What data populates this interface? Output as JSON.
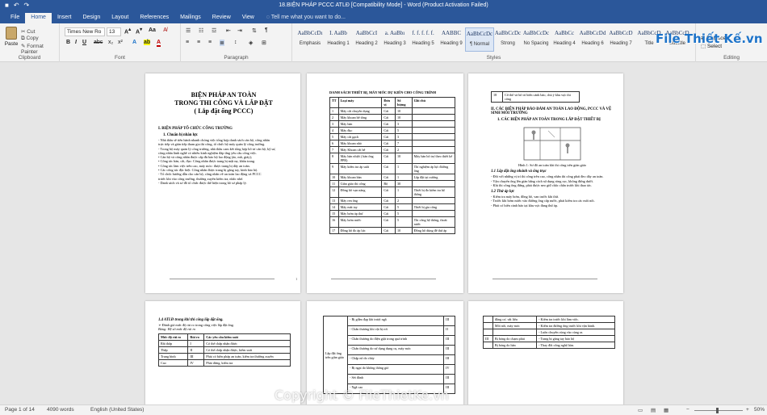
{
  "window": {
    "title": "18.BIỆN PHÁP PCCC  ATLĐ [Compatibility Mode] - Word (Product Activation Failed)"
  },
  "tabs": [
    "File",
    "Home",
    "Insert",
    "Design",
    "Layout",
    "References",
    "Mailings",
    "Review",
    "View"
  ],
  "active_tab": "Home",
  "tell_me": "Tell me what you want to do...",
  "clipboard": {
    "paste": "Paste",
    "cut": "Cut",
    "copy": "Copy",
    "format_painter": "Format Painter",
    "label": "Clipboard"
  },
  "font": {
    "name": "Times New Ro",
    "size": "13",
    "label": "Font"
  },
  "paragraph": {
    "label": "Paragraph"
  },
  "styles": {
    "label": "Styles",
    "items": [
      {
        "preview": "AaBbCcDı",
        "name": "Emphasis"
      },
      {
        "preview": "I. AaBb",
        "name": "Heading 1"
      },
      {
        "preview": "AaBbCcI",
        "name": "Heading 2"
      },
      {
        "preview": "a. AaBbı",
        "name": "Heading 3"
      },
      {
        "preview": "f. f. f. f. f.",
        "name": "Heading 5"
      },
      {
        "preview": "AABBC",
        "name": "Heading 9"
      },
      {
        "preview": "AaBbCcDc",
        "name": "¶ Normal"
      },
      {
        "preview": "AaBbCcDc",
        "name": "Strong"
      },
      {
        "preview": "AaBbCcDc",
        "name": "No Spacing"
      },
      {
        "preview": "AaBbCc",
        "name": "Heading 4"
      },
      {
        "preview": "AaBbCcDd",
        "name": "Heading 6"
      },
      {
        "preview": "AaBbCcD",
        "name": "Heading 7"
      },
      {
        "preview": "AaBbCcD",
        "name": "Title"
      },
      {
        "preview": "AaBbCcD",
        "name": "Subtitle"
      }
    ]
  },
  "editing": {
    "replace": "Replace",
    "select": "Select",
    "label": "Editing"
  },
  "logo": "File Thiết Kế.vn",
  "page1": {
    "title1": "BIỆN PHÁP AN TOÀN",
    "title2": "TRONG THI CÔNG VÀ LẮP ĐẶT",
    "title3": "( Lắp đặt ống PCCC)",
    "h1": "I. BIỆN PHÁP TỔ CHỨC CÔNG TRƯỜNG",
    "h2": "1.   Chuẩn bị nhân lực",
    "lines": [
      "- Nhà thầu sẽ tiến hành nhanh chóng việc tổng hợp danh sách cán bộ, công nhân",
      "trực tiếp và gián tiếp tham gia thi công, tổ chức bộ máy quản lý công trường.",
      "- Trong bộ máy quản lý công trường, nhà thầu cam kết tổng hợp bố trí cán bộ, kỹ sư,",
      "công nhân lành nghề có nhiều kinh nghiệm đáp ứng yêu cầu công việc.",
      "• Cán bộ và công nhân được cấp đủ bảo hộ lao động (áo, mũ, giày);",
      "• Công tác bàn, cắt, đục: Công nhân được trang bị mặt nạ, khẩu trang.",
      "• Công tác làm việc trên cao, máy móc: được trang bị dây an toàn.",
      "• Các công tác đặc biệt: Công nhân được trang bị găng tay, kính bảo hộ.",
      "- Tổ chức hướng dẫn cho cán bộ, công nhân về an toàn lao động và PCCC",
      "trước khi vào công trường, thường xuyên kiểm tra, nhắc nhở.",
      "- Danh sách và sơ đồ tổ chức được thể hiện trong hồ sơ pháp lý."
    ],
    "num": "1"
  },
  "page2": {
    "title": "DANH SÁCH THIẾT BỊ, MÁY MÓC DỰ KIẾN CHO CÔNG TRÌNH",
    "headers": [
      "TT",
      "Loại máy",
      "Đơn vị",
      "Số lượng",
      "Ghi chú"
    ],
    "rows": [
      [
        "1",
        "Máy cắt chuyên dụng",
        "Cái",
        "10",
        ""
      ],
      [
        "2",
        "Máy khoan bê tông",
        "Cái",
        "10",
        ""
      ],
      [
        "3",
        "Máy hàn",
        "Cái",
        "3",
        ""
      ],
      [
        "4",
        "Máy đục",
        "Cái",
        "5",
        ""
      ],
      [
        "5",
        "Máy cắt gạch",
        "Cái",
        "3",
        ""
      ],
      [
        "6",
        "Máy khoan nhỏ",
        "Cái",
        "7",
        ""
      ],
      [
        "7",
        "Máy Khoan cắt bê",
        "Cái",
        "2",
        ""
      ],
      [
        "8",
        "Máy hàn nhiệt ( hàn ống PPR)",
        "Cái",
        "10",
        "Máy hàn bổ trợ theo thiết kế"
      ],
      [
        "9",
        "Máy kiểm tra áp suất",
        "Cái",
        "1",
        "Thí nghiệm áp lực đường ống"
      ],
      [
        "10",
        "Máy khoan bàn",
        "Cái",
        "1",
        "Lắp đặt tại xưởng"
      ],
      [
        "11",
        "Giàn giáo thi công",
        "Bộ",
        "30",
        ""
      ],
      [
        "12",
        "Đồng hồ vạn năng",
        "Cái",
        "1",
        "Thiết bị đo kiểm tra hệ thống"
      ],
      [
        "13",
        "Máy ren ống",
        "Cái",
        "2",
        ""
      ],
      [
        "14",
        "Máy mài tay",
        "Cái",
        "5",
        "Thiết bị gia công"
      ],
      [
        "15",
        "Máy bơm áp thử",
        "Cái",
        "5",
        ""
      ],
      [
        "16",
        "Máy bơm nước",
        "Cái",
        "5",
        "Thi công hệ thống, thoát nước"
      ],
      [
        "17",
        "Đồng hồ đo áp lực",
        "Cái",
        "10",
        "Đồng hồ dùng để thử áp"
      ]
    ]
  },
  "page3": {
    "cell_no": "18",
    "cell_text": "Cờ thể và bố trí biển cảnh báo, chú ý khu vực thi công",
    "h1": "II.  CÁC BIỆN PHÁP BẢO ĐẢM AN TOÀN LAO ĐỘNG, PCCC VÀ VỆ SINH MÔI TRƯỜNG",
    "h2": "1.   CÁC BIỆN PHÁP AN TOÀN TRONG LẮP ĐẶT THIẾT BỊ",
    "caption": "Hình 1: Sơ đồ an toàn khi thi công trên giàn giáo",
    "sub1": "1.1 Lắp đặt ống nhánh và ống trục",
    "lines1": [
      "- Đối với những vị trí thi công trên cao, công nhân thi công phải đeo dây an toàn.",
      "- Vận chuyển ống lên giàn bằng cách sử dụng ròng rọc, không đứng dưới.",
      "- Khi thi công ống đứng, phải được neo giữ chắc chắn trước khi thao tác."
    ],
    "sub2": "1.2 Thử áp lực",
    "lines2": [
      "- Kiểm tra máy bơm, đồng hồ, van trước khi thử.",
      "- Trước khi bơm nước vào đường ống cấp nước, phải kiểm tra các mối nối.",
      "- Phải có biển cảnh báo tại khu vực đang thử áp."
    ]
  },
  "page4": {
    "h1": "1.4 ATLĐ trong khi thi công lắp đặt ống.",
    "h2": "➢ Đánh giá mức độ rủi ro trong công việc lắp đặt ống.",
    "caption": "Bảng: Hệ số mức độ rủi ro",
    "headers": [
      "Mức độ rủi ro",
      "Rủi ro",
      "Các yêu cầu kiểm soát"
    ],
    "rows": [
      [
        "Rất thấp",
        "I",
        "Có thể chấp nhận được"
      ],
      [
        "Thấp",
        "II",
        "Có thể chấp nhận được, kiểm soát"
      ],
      [
        "Trung bình",
        "III",
        "Phải có biện pháp an toàn, kiểm tra thường xuyên"
      ],
      [
        "Cao",
        "IV",
        "Phải dừng, kiểm tra"
      ]
    ]
  },
  "page5": {
    "side_label": "Lắp đặt ống trên giàn giáo",
    "rows": [
      [
        "- Bị giẫm đạp khi trượt ngã",
        "III"
      ],
      [
        "- Chấn thương khi vật bị rơi",
        "II"
      ],
      [
        "- Chấn thương do điện giật trong quá trình",
        "III"
      ],
      [
        "- Chấn thương do sử dụng dụng cụ, máy móc",
        "III"
      ],
      [
        "- Chập nổ do cháy",
        "III"
      ],
      [
        "- Bị ngạt do không thông gió",
        "IV"
      ],
      [
        "- Sét đánh",
        "III"
      ],
      [
        "- Ngã cao",
        "III"
      ]
    ]
  },
  "page6": {
    "rows": [
      [
        "",
        "động cơ, vật liệu",
        "- Kiểm tra trước khi làm việc."
      ],
      [
        "",
        "Mối nối, máy móc",
        "- Kiểm tra đường ống trước khi vận hành."
      ],
      [
        "",
        "",
        "- Luôn chuyên cùng vào cùng ra."
      ],
      [
        "III",
        "Bị bỏng do chạm phải",
        "- Trang bị găng tay bảo hộ"
      ],
      [
        "",
        "Bị bỏng do hàn",
        "- Thay đổi công nghệ hàn."
      ]
    ]
  },
  "status": {
    "page": "Page 1 of 14",
    "words": "4090 words",
    "language": "English (United States)",
    "zoom": "50%"
  },
  "watermark": "Copyright © FileThietKe.vn"
}
